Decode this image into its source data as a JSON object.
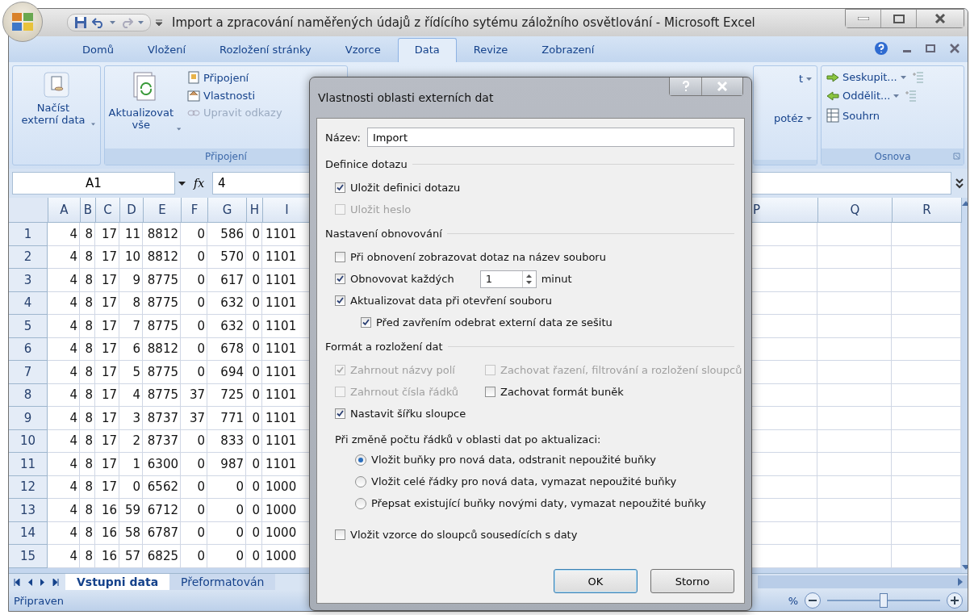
{
  "window": {
    "title": "Import a zpracování naměřených údajů z řídícího sytému záložního osvětlování - Microsoft Excel"
  },
  "ribbon_tabs": [
    {
      "label": "Domů",
      "selected": false
    },
    {
      "label": "Vložení",
      "selected": false
    },
    {
      "label": "Rozložení stránky",
      "selected": false
    },
    {
      "label": "Vzorce",
      "selected": false
    },
    {
      "label": "Data",
      "selected": true
    },
    {
      "label": "Revize",
      "selected": false
    },
    {
      "label": "Zobrazení",
      "selected": false
    }
  ],
  "ribbon": {
    "get_external_data": "Načíst externí data",
    "refresh_all": "Aktualizovat vše",
    "connections_items": [
      {
        "label": "Připojení",
        "disabled": false
      },
      {
        "label": "Vlastnosti",
        "disabled": false
      },
      {
        "label": "Upravit odkazy",
        "disabled": true
      }
    ],
    "connections_group_label": "Připojení",
    "partial_items": [
      "t",
      "potéz"
    ],
    "outline_items": [
      {
        "label": "Seskupit..."
      },
      {
        "label": "Oddělit..."
      },
      {
        "label": "Souhrn"
      }
    ],
    "outline_group_label": "Osnova"
  },
  "formula_bar": {
    "name_box": "A1",
    "fx_label": "fx",
    "value": "4"
  },
  "sheet": {
    "columns": [
      "A",
      "B",
      "C",
      "D",
      "E",
      "F",
      "G",
      "H",
      "I"
    ],
    "right_columns": [
      "P",
      "Q",
      "R"
    ],
    "rows": [
      {
        "header": "1",
        "cells": [
          "4",
          "8",
          "17",
          "11",
          "8812",
          "0",
          "586",
          "0",
          "1101"
        ]
      },
      {
        "header": "2",
        "cells": [
          "4",
          "8",
          "17",
          "10",
          "8812",
          "0",
          "570",
          "0",
          "1101"
        ]
      },
      {
        "header": "3",
        "cells": [
          "4",
          "8",
          "17",
          "9",
          "8775",
          "0",
          "617",
          "0",
          "1101"
        ]
      },
      {
        "header": "4",
        "cells": [
          "4",
          "8",
          "17",
          "8",
          "8775",
          "0",
          "632",
          "0",
          "1101"
        ]
      },
      {
        "header": "5",
        "cells": [
          "4",
          "8",
          "17",
          "7",
          "8775",
          "0",
          "632",
          "0",
          "1101"
        ]
      },
      {
        "header": "6",
        "cells": [
          "4",
          "8",
          "17",
          "6",
          "8812",
          "0",
          "678",
          "0",
          "1101"
        ]
      },
      {
        "header": "7",
        "cells": [
          "4",
          "8",
          "17",
          "5",
          "8775",
          "0",
          "694",
          "0",
          "1101"
        ]
      },
      {
        "header": "8",
        "cells": [
          "4",
          "8",
          "17",
          "4",
          "8775",
          "37",
          "725",
          "0",
          "1101"
        ]
      },
      {
        "header": "9",
        "cells": [
          "4",
          "8",
          "17",
          "3",
          "8737",
          "37",
          "771",
          "0",
          "1101"
        ]
      },
      {
        "header": "10",
        "cells": [
          "4",
          "8",
          "17",
          "2",
          "8737",
          "0",
          "833",
          "0",
          "1101"
        ]
      },
      {
        "header": "11",
        "cells": [
          "4",
          "8",
          "17",
          "1",
          "6300",
          "0",
          "987",
          "0",
          "1101"
        ]
      },
      {
        "header": "12",
        "cells": [
          "4",
          "8",
          "17",
          "0",
          "6562",
          "0",
          "0",
          "0",
          "1000"
        ]
      },
      {
        "header": "13",
        "cells": [
          "4",
          "8",
          "16",
          "59",
          "6712",
          "0",
          "0",
          "0",
          "1000"
        ]
      },
      {
        "header": "14",
        "cells": [
          "4",
          "8",
          "16",
          "58",
          "6787",
          "0",
          "0",
          "0",
          "1000"
        ]
      },
      {
        "header": "15",
        "cells": [
          "4",
          "8",
          "16",
          "57",
          "6825",
          "0",
          "0",
          "0",
          "1000"
        ]
      }
    ]
  },
  "sheet_tabs": [
    {
      "label": "Vstupni data",
      "selected": true
    },
    {
      "label": "Přeformatován",
      "selected": false
    }
  ],
  "status_bar": {
    "text": "Připraven",
    "zoom_text": "%",
    "zoom_slider": {
      "level": 0.5
    }
  },
  "dialog": {
    "title": "Vlastnosti oblasti externích dat",
    "name_label": "Název:",
    "name_value": "Import",
    "sections": [
      {
        "heading": "Definice dotazu",
        "items": [
          {
            "kind": "checkbox",
            "label": "Uložit definici dotazu",
            "checked": true,
            "disabled": false
          },
          {
            "kind": "checkbox",
            "label": "Uložit heslo",
            "checked": false,
            "disabled": true
          }
        ]
      },
      {
        "heading": "Nastavení obnovování",
        "items": [
          {
            "kind": "checkbox",
            "label": "Při obnovení zobrazovat dotaz na název souboru",
            "checked": false,
            "disabled": false
          },
          {
            "kind": "interval",
            "label": "Obnovovat každých",
            "checked": true,
            "disabled": false,
            "value": "1",
            "unit": "minut"
          },
          {
            "kind": "checkbox",
            "label": "Aktualizovat data při otevření souboru",
            "checked": true,
            "disabled": false,
            "children": [
              {
                "kind": "checkbox",
                "label": "Před zavřením odebrat externí data ze sešitu",
                "checked": true,
                "disabled": false
              }
            ]
          }
        ]
      },
      {
        "heading": "Formát a rozložení dat",
        "items": [
          {
            "kind": "pair",
            "options": [
              {
                "label": "Zahrnout názvy polí",
                "checked": true,
                "disabled": true
              },
              {
                "label": "Zachovat řazení, filtrování a rozložení sloupců",
                "checked": false,
                "disabled": true
              }
            ]
          },
          {
            "kind": "pair",
            "options": [
              {
                "label": "Zahrnout čísla řádků",
                "checked": false,
                "disabled": true
              },
              {
                "label": "Zachovat formát buněk",
                "checked": false,
                "disabled": false
              }
            ]
          },
          {
            "kind": "checkbox",
            "label": "Nastavit šířku sloupce",
            "checked": true,
            "disabled": false
          },
          {
            "kind": "radio-group",
            "label": "Při změně počtu řádků v oblasti dat po aktualizaci:",
            "options": [
              {
                "label": "Vložit buňky pro nová data, odstranit nepoužité buňky",
                "selected": true
              },
              {
                "label": "Vložit celé řádky pro nová data, vymazat nepoužité buňky",
                "selected": false
              },
              {
                "label": "Přepsat existující buňky novými daty, vymazat nepoužité buňky",
                "selected": false
              }
            ]
          },
          {
            "kind": "checkbox",
            "label": "Vložit vzorce do sloupců sousedících s daty",
            "checked": false,
            "disabled": false
          }
        ]
      }
    ],
    "buttons": [
      {
        "label": "OK",
        "default": true
      },
      {
        "label": "Storno",
        "default": false
      }
    ]
  }
}
